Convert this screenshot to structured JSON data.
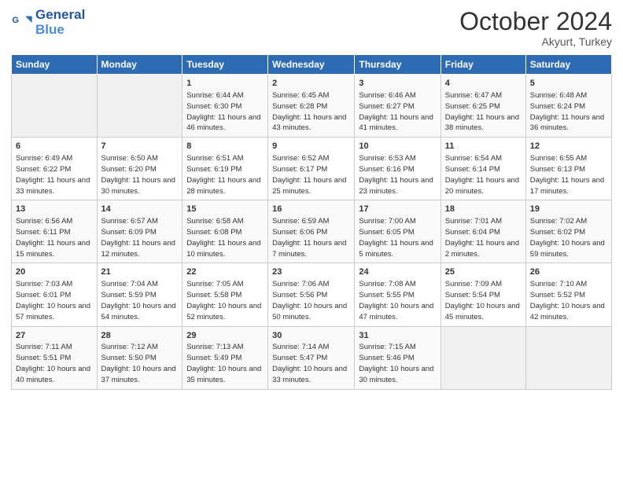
{
  "header": {
    "logo_line1": "General",
    "logo_line2": "Blue",
    "month": "October 2024",
    "location": "Akyurt, Turkey"
  },
  "days_of_week": [
    "Sunday",
    "Monday",
    "Tuesday",
    "Wednesday",
    "Thursday",
    "Friday",
    "Saturday"
  ],
  "weeks": [
    [
      {
        "day": "",
        "info": ""
      },
      {
        "day": "",
        "info": ""
      },
      {
        "day": "1",
        "info": "Sunrise: 6:44 AM\nSunset: 6:30 PM\nDaylight: 11 hours and 46 minutes."
      },
      {
        "day": "2",
        "info": "Sunrise: 6:45 AM\nSunset: 6:28 PM\nDaylight: 11 hours and 43 minutes."
      },
      {
        "day": "3",
        "info": "Sunrise: 6:46 AM\nSunset: 6:27 PM\nDaylight: 11 hours and 41 minutes."
      },
      {
        "day": "4",
        "info": "Sunrise: 6:47 AM\nSunset: 6:25 PM\nDaylight: 11 hours and 38 minutes."
      },
      {
        "day": "5",
        "info": "Sunrise: 6:48 AM\nSunset: 6:24 PM\nDaylight: 11 hours and 36 minutes."
      }
    ],
    [
      {
        "day": "6",
        "info": "Sunrise: 6:49 AM\nSunset: 6:22 PM\nDaylight: 11 hours and 33 minutes."
      },
      {
        "day": "7",
        "info": "Sunrise: 6:50 AM\nSunset: 6:20 PM\nDaylight: 11 hours and 30 minutes."
      },
      {
        "day": "8",
        "info": "Sunrise: 6:51 AM\nSunset: 6:19 PM\nDaylight: 11 hours and 28 minutes."
      },
      {
        "day": "9",
        "info": "Sunrise: 6:52 AM\nSunset: 6:17 PM\nDaylight: 11 hours and 25 minutes."
      },
      {
        "day": "10",
        "info": "Sunrise: 6:53 AM\nSunset: 6:16 PM\nDaylight: 11 hours and 23 minutes."
      },
      {
        "day": "11",
        "info": "Sunrise: 6:54 AM\nSunset: 6:14 PM\nDaylight: 11 hours and 20 minutes."
      },
      {
        "day": "12",
        "info": "Sunrise: 6:55 AM\nSunset: 6:13 PM\nDaylight: 11 hours and 17 minutes."
      }
    ],
    [
      {
        "day": "13",
        "info": "Sunrise: 6:56 AM\nSunset: 6:11 PM\nDaylight: 11 hours and 15 minutes."
      },
      {
        "day": "14",
        "info": "Sunrise: 6:57 AM\nSunset: 6:09 PM\nDaylight: 11 hours and 12 minutes."
      },
      {
        "day": "15",
        "info": "Sunrise: 6:58 AM\nSunset: 6:08 PM\nDaylight: 11 hours and 10 minutes."
      },
      {
        "day": "16",
        "info": "Sunrise: 6:59 AM\nSunset: 6:06 PM\nDaylight: 11 hours and 7 minutes."
      },
      {
        "day": "17",
        "info": "Sunrise: 7:00 AM\nSunset: 6:05 PM\nDaylight: 11 hours and 5 minutes."
      },
      {
        "day": "18",
        "info": "Sunrise: 7:01 AM\nSunset: 6:04 PM\nDaylight: 11 hours and 2 minutes."
      },
      {
        "day": "19",
        "info": "Sunrise: 7:02 AM\nSunset: 6:02 PM\nDaylight: 10 hours and 59 minutes."
      }
    ],
    [
      {
        "day": "20",
        "info": "Sunrise: 7:03 AM\nSunset: 6:01 PM\nDaylight: 10 hours and 57 minutes."
      },
      {
        "day": "21",
        "info": "Sunrise: 7:04 AM\nSunset: 5:59 PM\nDaylight: 10 hours and 54 minutes."
      },
      {
        "day": "22",
        "info": "Sunrise: 7:05 AM\nSunset: 5:58 PM\nDaylight: 10 hours and 52 minutes."
      },
      {
        "day": "23",
        "info": "Sunrise: 7:06 AM\nSunset: 5:56 PM\nDaylight: 10 hours and 50 minutes."
      },
      {
        "day": "24",
        "info": "Sunrise: 7:08 AM\nSunset: 5:55 PM\nDaylight: 10 hours and 47 minutes."
      },
      {
        "day": "25",
        "info": "Sunrise: 7:09 AM\nSunset: 5:54 PM\nDaylight: 10 hours and 45 minutes."
      },
      {
        "day": "26",
        "info": "Sunrise: 7:10 AM\nSunset: 5:52 PM\nDaylight: 10 hours and 42 minutes."
      }
    ],
    [
      {
        "day": "27",
        "info": "Sunrise: 7:11 AM\nSunset: 5:51 PM\nDaylight: 10 hours and 40 minutes."
      },
      {
        "day": "28",
        "info": "Sunrise: 7:12 AM\nSunset: 5:50 PM\nDaylight: 10 hours and 37 minutes."
      },
      {
        "day": "29",
        "info": "Sunrise: 7:13 AM\nSunset: 5:49 PM\nDaylight: 10 hours and 35 minutes."
      },
      {
        "day": "30",
        "info": "Sunrise: 7:14 AM\nSunset: 5:47 PM\nDaylight: 10 hours and 33 minutes."
      },
      {
        "day": "31",
        "info": "Sunrise: 7:15 AM\nSunset: 5:46 PM\nDaylight: 10 hours and 30 minutes."
      },
      {
        "day": "",
        "info": ""
      },
      {
        "day": "",
        "info": ""
      }
    ]
  ]
}
